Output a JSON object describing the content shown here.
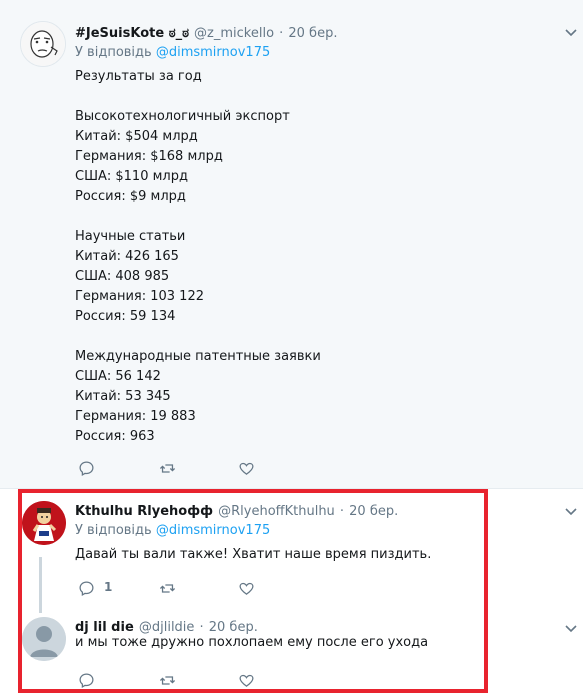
{
  "tweets": [
    {
      "name": "#JeSuisKote ಠ_ಠ",
      "handle": "@z_mickello",
      "sep": "·",
      "time": "20 бер.",
      "reply_prefix": "У відповідь",
      "reply_user": "@dimsmirnov175",
      "text": "Результаты за год\n\nВысокотехнологичный экспорт\nКитай: $504 млрд\nГермания: $168 млрд\nСША: $110 млрд\nРоссия: $9 млрд\n\nНаучные статьи\nКитай: 426 165\nСША: 408 985\nГермания: 103 122\nРоссия: 59 134\n\nМеждународные патентные заявки\nСША: 56 142\nКитай: 53 345\nГермания: 19 883\nРоссия: 963",
      "reply_count": "",
      "retweet_count": "",
      "like_count": ""
    },
    {
      "name": "Kthulhu Rlyehoфф",
      "handle": "@RlyehoffKthulhu",
      "sep": "·",
      "time": "20 бер.",
      "reply_prefix": "У відповідь",
      "reply_user": "@dimsmirnov175",
      "text": "Давай ты вали также! Хватит наше время пиздить.",
      "reply_count": "1",
      "retweet_count": "",
      "like_count": ""
    },
    {
      "name": "dj lil die",
      "handle": "@djlildie",
      "sep": "·",
      "time": "20 бер.",
      "text": "и мы тоже дружно похлопаем ему после его ухода"
    }
  ],
  "colors": {
    "accent": "#1da1f2",
    "muted": "#657786",
    "highlight_border": "#e8232e",
    "selected_bg": "#f5f8fa"
  },
  "icons": [
    "reply-icon",
    "retweet-icon",
    "like-icon",
    "chevron-down-icon"
  ]
}
